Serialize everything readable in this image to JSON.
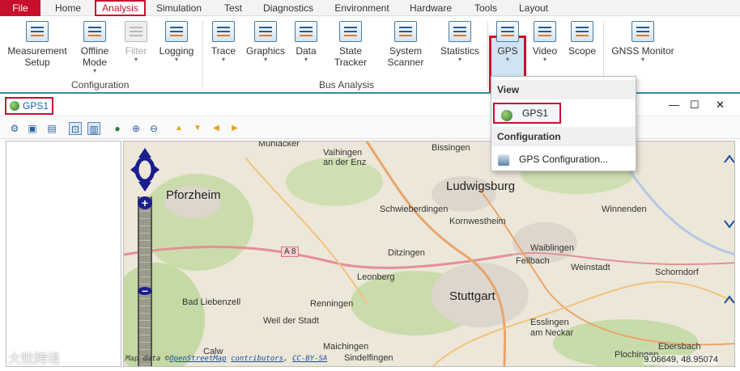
{
  "menubar": {
    "tabs": [
      "File",
      "Home",
      "Analysis",
      "Simulation",
      "Test",
      "Diagnostics",
      "Environment",
      "Hardware",
      "Tools",
      "Layout"
    ]
  },
  "ribbon": {
    "buttons": [
      "Measurement\nSetup",
      "Offline\nMode",
      "Filter",
      "Logging",
      "Trace",
      "Graphics",
      "Data",
      "State\nTracker",
      "System\nScanner",
      "Statistics",
      "GPS",
      "Video",
      "Scope",
      "GNSS Monitor"
    ],
    "groups": {
      "configuration": "Configuration",
      "bus_analysis": "Bus Analysis"
    }
  },
  "document": {
    "tab_label": "GPS1"
  },
  "window_controls": {
    "minimize": "—",
    "maximize": "☐",
    "close": "✕"
  },
  "map": {
    "cities": [
      "Mühlacker",
      "Vaihingen\nan der Enz",
      "Bissingen",
      "Pforzheim",
      "Ludwigsburg",
      "Schwieberdingen",
      "Kornwestheim",
      "Winnenden",
      "A 8",
      "Ditzingen",
      "Waiblingen",
      "Fellbach",
      "Weinstadt",
      "Schorndorf",
      "Leonberg",
      "Stuttgart",
      "Bad Liebenzell",
      "Renningen",
      "Weil der Stadt",
      "Esslingen\nam Neckar",
      "Maichingen",
      "Sindelfingen",
      "Calw",
      "Plochingen",
      "Ebersbach"
    ],
    "attribution": {
      "prefix": "Map data ©",
      "link1": "OpenStreetMap",
      "link2": "contributors",
      "sep": ", ",
      "link3": "CC-BY-SA"
    },
    "coordinates": "9.06649, 48.95074"
  },
  "dropdown": {
    "view_header": "View",
    "item_gps1": "GPS1",
    "config_header": "Configuration",
    "item_config": "GPS Configuration..."
  },
  "watermark": "大败跨境",
  "colors": {
    "accent": "#c8102e",
    "ribbon_border": "#3a8ba0"
  }
}
